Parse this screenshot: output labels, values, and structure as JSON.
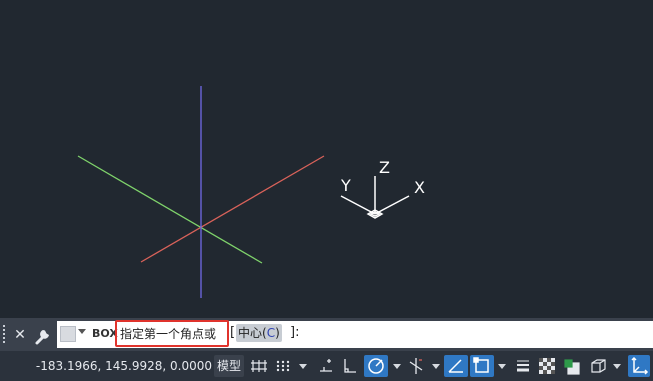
{
  "viewport": {
    "ucs_labels": {
      "x": "X",
      "y": "Y",
      "z": "Z"
    },
    "colors": {
      "background": "#212830",
      "x_axis": "#d9625a",
      "y_axis": "#7fd36b",
      "z_axis": "#6f69e6",
      "ucs": "#ffffff"
    }
  },
  "command_line": {
    "command_name": "BOX",
    "prompt_text": "指定第一个角点或",
    "bracket_open": "[",
    "option_label": "中心(",
    "option_key": "C",
    "option_close": ")",
    "bracket_close": "]:",
    "highlight_color": "#e0332c"
  },
  "status_bar": {
    "coordinates": "-183.1966, 145.9928, 0.0000",
    "model_label": "模型",
    "icons": [
      "grid-icon",
      "snap-grid-icon",
      "infer-icon",
      "ortho-icon",
      "polar-tracking-icon",
      "isodraft-icon",
      "object-snap-tracking-icon",
      "object-snap-icon",
      "lineweight-icon",
      "transparency-icon",
      "selection-cycling-icon",
      "3d-object-snap-icon",
      "dynamic-ucs-icon"
    ],
    "accent": "#2f78c4"
  }
}
